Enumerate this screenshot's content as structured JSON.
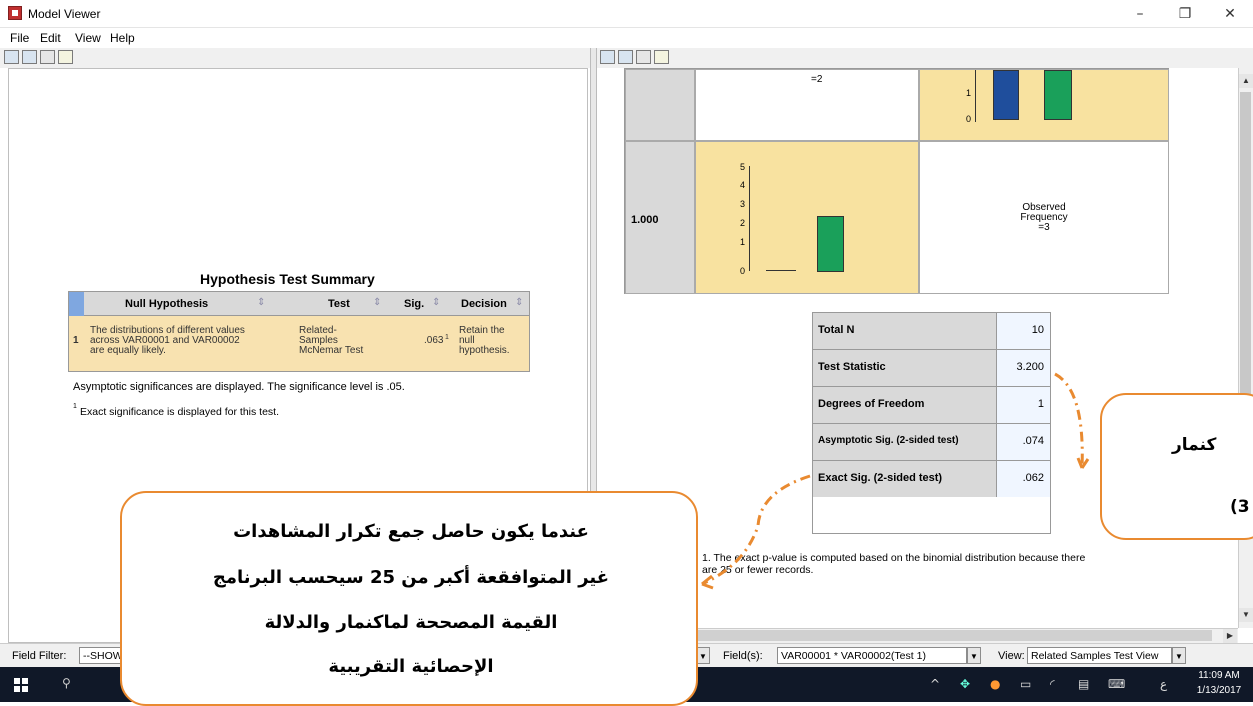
{
  "window": {
    "title": "Model Viewer",
    "minimize": "–",
    "restore": "❐",
    "close": "✕"
  },
  "menu": {
    "file": "File",
    "edit": "Edit",
    "view": "View",
    "help": "Help"
  },
  "left": {
    "table_title": "Hypothesis Test Summary",
    "headers": {
      "null_hypothesis": "Null Hypothesis",
      "test": "Test",
      "sig": "Sig.",
      "decision": "Decision"
    },
    "row": {
      "num": "1",
      "hyp1": "The distributions of different values",
      "hyp2": "across VAR00001 and VAR00002",
      "hyp3": "are equally likely.",
      "test1": "Related-",
      "test2": "Samples",
      "test3": "McNemar Test",
      "sig": ".063",
      "sig_sup": "1",
      "dec1": "Retain the",
      "dec2": "null",
      "dec3": "hypothesis."
    },
    "note1": "Asymptotic significances are displayed.  The significance level is .05.",
    "note2_sup": "1",
    "note2": "Exact significance is displayed for this test."
  },
  "right": {
    "top_freq_text": "=2",
    "row_label": "1.000",
    "ticks_top": [
      "1",
      "0"
    ],
    "ticks_bottom": [
      "5",
      "4",
      "3",
      "2",
      "1",
      "0"
    ],
    "observed1": "Observed",
    "observed2": "Frequency",
    "observed3": "=3",
    "stats": [
      {
        "label": "Total N",
        "value": "10"
      },
      {
        "label": "Test Statistic",
        "value": "3.200"
      },
      {
        "label": "Degrees of Freedom",
        "value": "1"
      },
      {
        "label": "Asymptotic Sig. (2-sided test)",
        "value": ".074"
      },
      {
        "label": "Exact Sig. (2-sided test)",
        "value": ".062"
      }
    ],
    "footnote1": "1.  The exact p-value is computed based on the binomial distribution because there",
    "footnote2": "are 25 or fewer records."
  },
  "colors": {
    "bar_blue": "#1f4e9c",
    "bar_green": "#1aa05a",
    "cell_yellow": "#f8e2a0",
    "callout_border": "#e98a30"
  },
  "bottom": {
    "field_filter_label": "Field Filter:",
    "field_filter_value": "--SHOW",
    "fields_label": "Field(s):",
    "fields_value": "VAR00001 * VAR00002(Test 1)",
    "view_label": "View:",
    "view_value": "Related Samples Test View"
  },
  "taskbar": {
    "time": "11:09 AM",
    "date": "1/13/2017"
  },
  "callout_main": {
    "line1": "عندما يكون حاصل جمع تكرار المشاهدات",
    "line2": "غير المتوافقعة أكبر من 25 سيحسب البرنامج",
    "line3": "القيمة المصححة لماكنمار  والدلالة",
    "line4": "الإحصائية التقريبية"
  },
  "callout_right": {
    "line1": "كنمار",
    "line2": "(3"
  }
}
